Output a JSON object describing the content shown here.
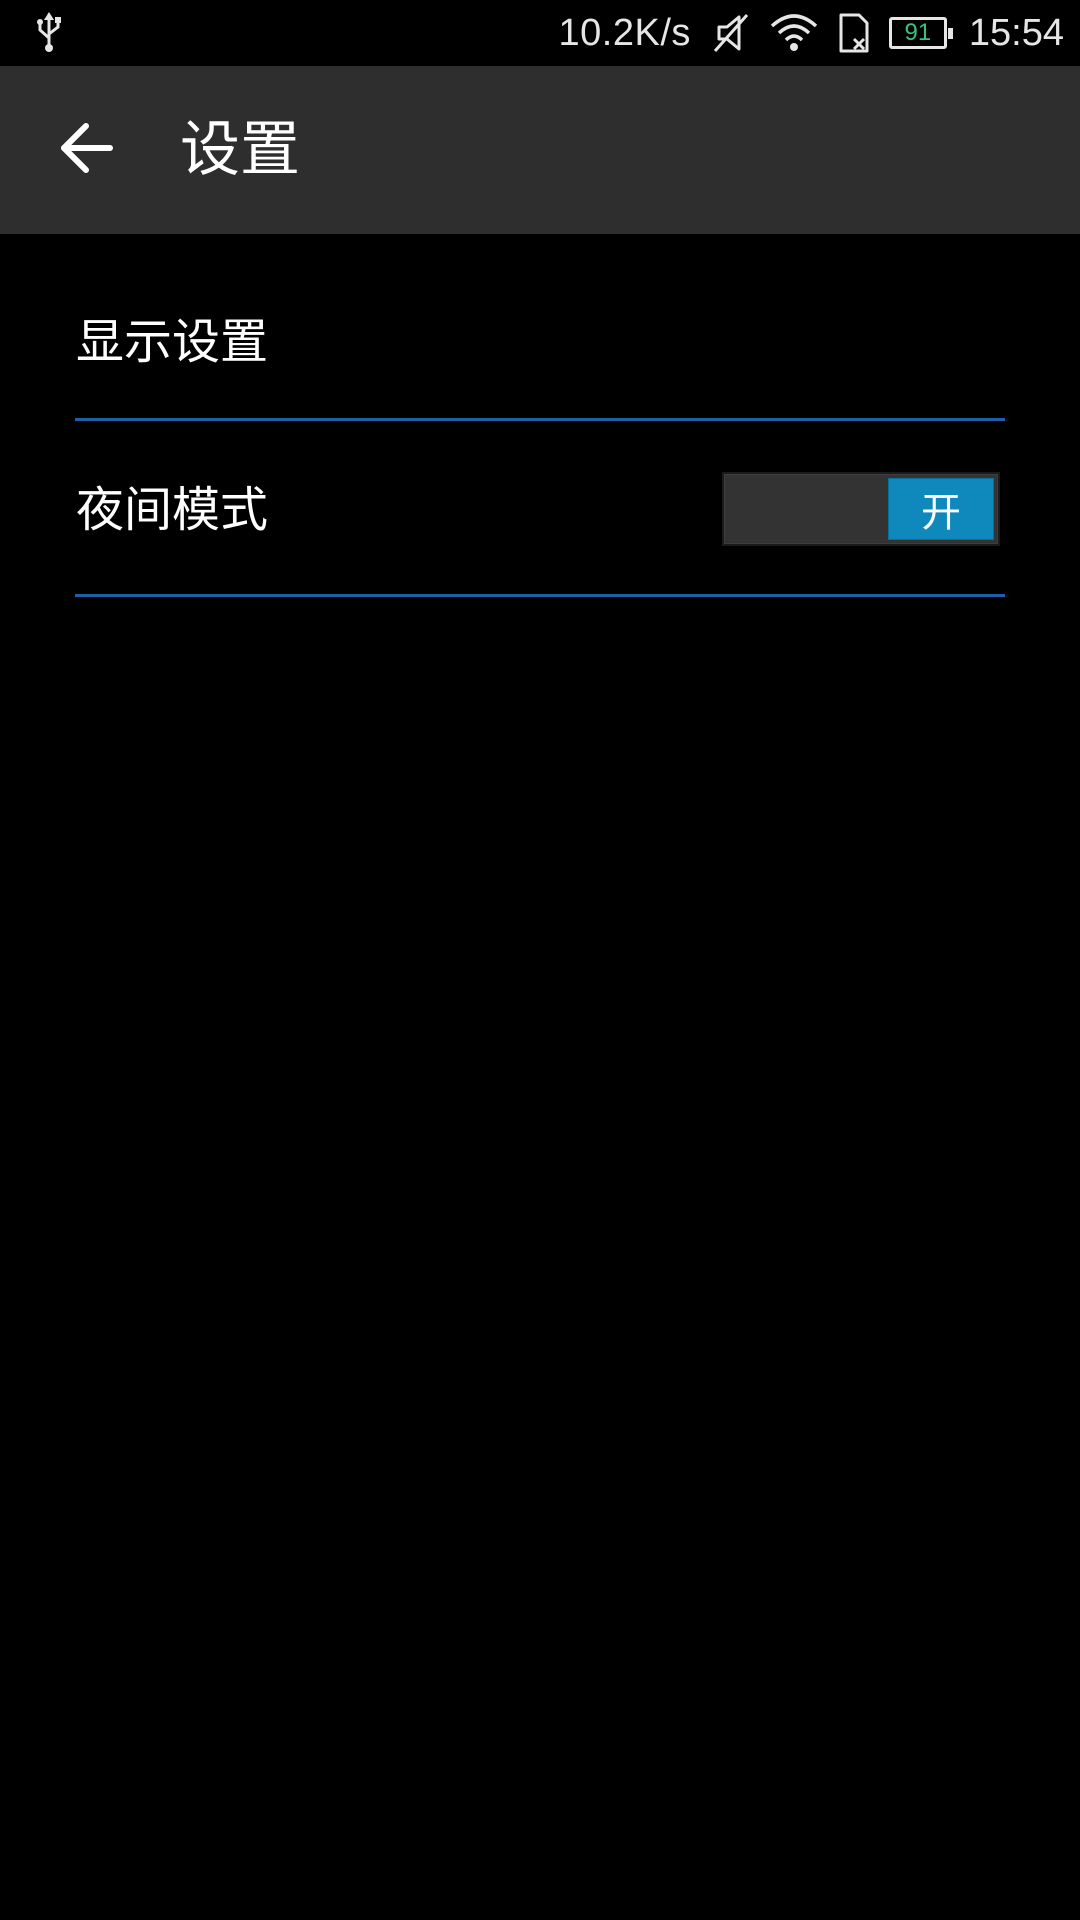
{
  "status_bar": {
    "network_speed": "10.2K/s",
    "battery_level": "91",
    "time": "15:54",
    "icons": [
      "usb-icon",
      "mute-icon",
      "wifi-icon",
      "no-sim-icon",
      "battery-icon"
    ],
    "battery_level_color": "#38c27a"
  },
  "action_bar": {
    "title": "设置",
    "back_icon": "back-arrow-icon",
    "background": "#2e2e2e"
  },
  "settings": {
    "items": [
      {
        "label": "显示设置"
      },
      {
        "label": "夜间模式",
        "toggle_label": "开",
        "toggle_on": true
      }
    ],
    "divider_color": "#1f5fa8",
    "toggle_on_color": "#0f88bb"
  }
}
